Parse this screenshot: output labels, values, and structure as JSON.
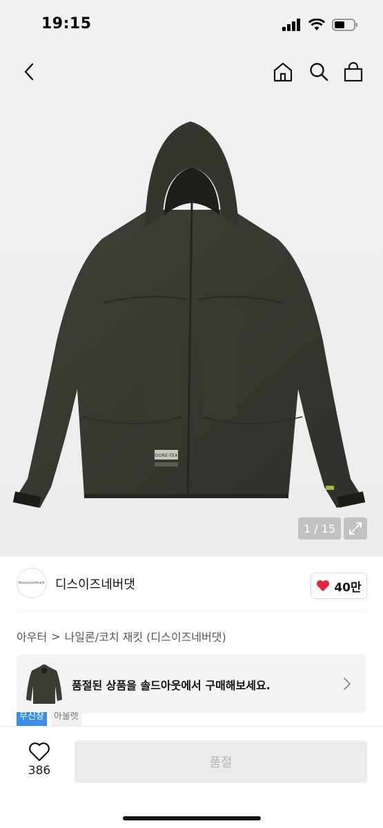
{
  "status": {
    "time": "19:15"
  },
  "gallery": {
    "counter": "1 / 15",
    "garment_logo": "GORE-TEX"
  },
  "shop": {
    "logo_text": "thisisneverthat®",
    "name": "디스이즈네버댓",
    "likes": "40만"
  },
  "category": {
    "parent": "아우터",
    "separator": ">",
    "child": "나일론/코치 재킷 (디스이즈네버댓)"
  },
  "soldout_banner": {
    "text": "품절된 상품을 솔드아웃에서 구매해보세요."
  },
  "tags": [
    "무신장",
    "아울렛"
  ],
  "bottom": {
    "wish_count": "386",
    "buy_label": "품절"
  },
  "colors": {
    "heart": "#e8243b",
    "tag_blue": "#3b8ee6",
    "jacket": "#3a3b31"
  },
  "icons": [
    "back-icon",
    "home-icon",
    "search-icon",
    "bag-icon",
    "expand-icon",
    "heart-icon",
    "chevron-right-icon"
  ]
}
